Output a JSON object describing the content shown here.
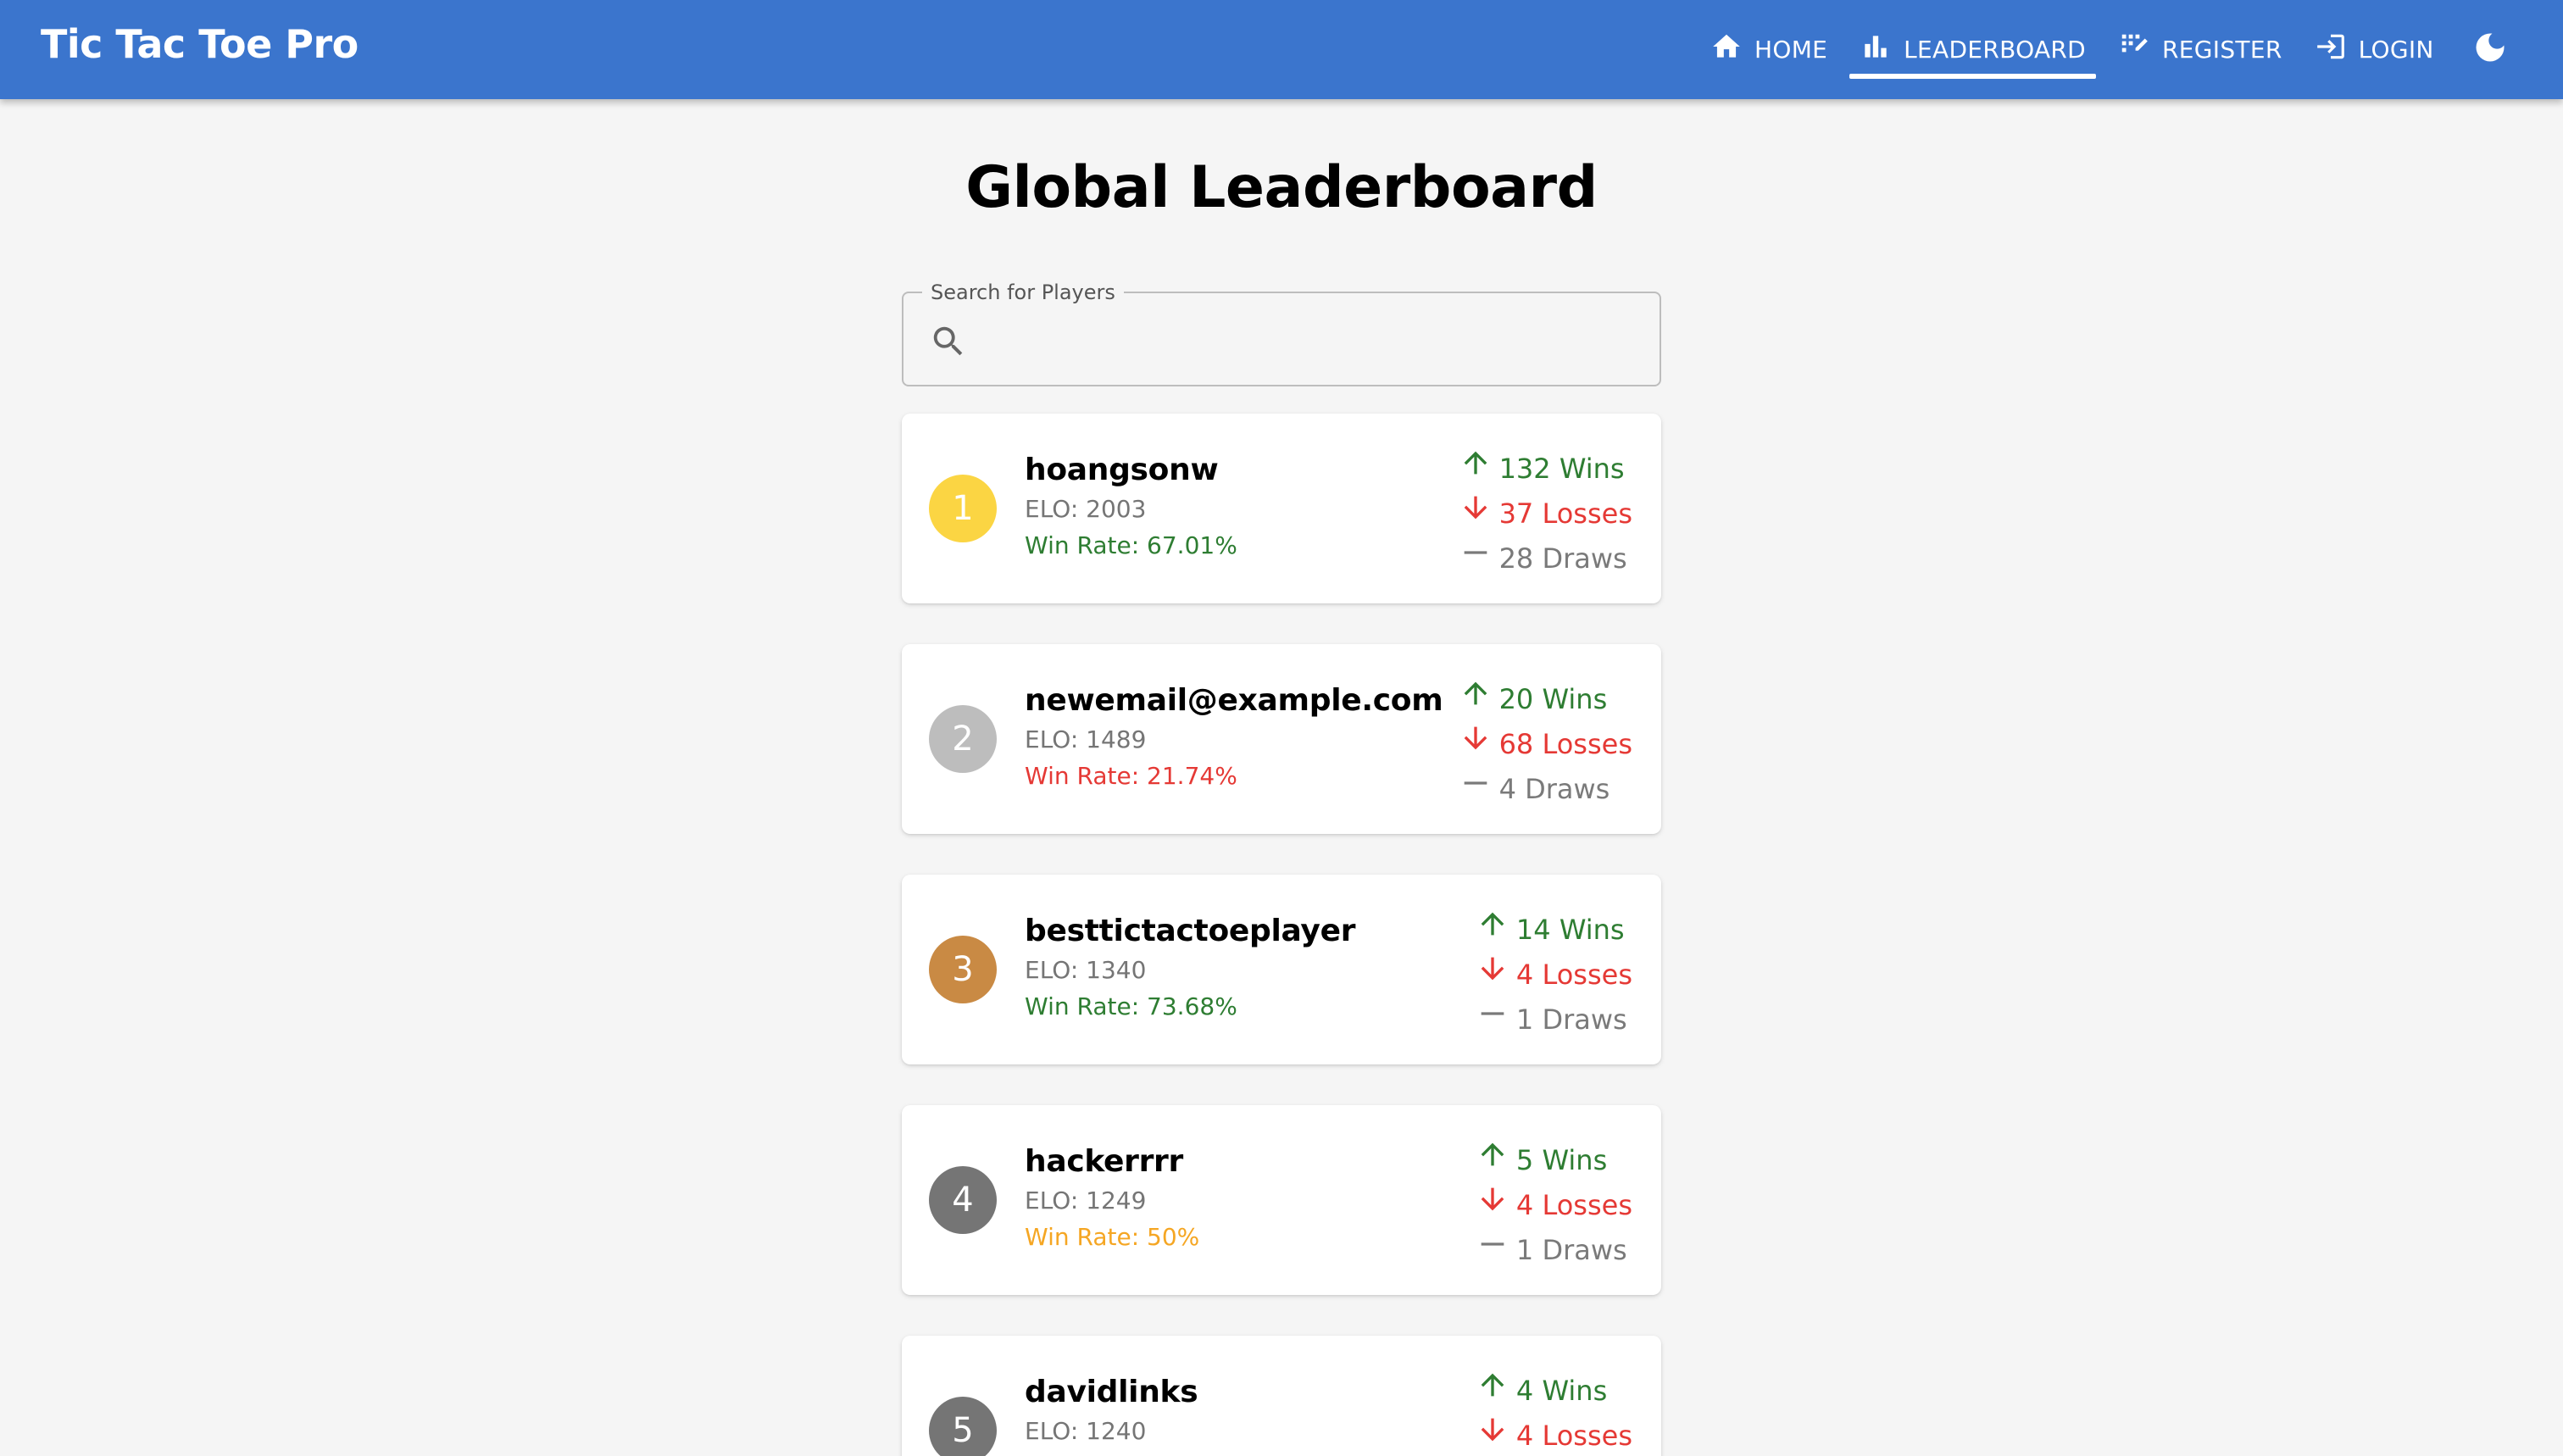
{
  "app": {
    "title": "Tic Tac Toe Pro"
  },
  "nav": {
    "home": "HOME",
    "leaderboard": "LEADERBOARD",
    "register": "REGISTER",
    "login": "LOGIN"
  },
  "page": {
    "title": "Global Leaderboard"
  },
  "search": {
    "label": "Search for Players",
    "value": ""
  },
  "colors": {
    "appbar": "#3b75cd",
    "gold": "#fbd543",
    "silver": "#bdbdbd",
    "bronze": "#c98a44",
    "default_rank": "#757575",
    "win": "#2e7d32",
    "loss": "#e53935",
    "draw": "#7a7a7a",
    "even": "#f5a623"
  },
  "players": [
    {
      "rank": "1",
      "name": "hoangsonw",
      "elo": "ELO: 2003",
      "win_rate": "Win Rate: 67.01%",
      "wins": "132 Wins",
      "losses": "37 Losses",
      "draws": "28 Draws"
    },
    {
      "rank": "2",
      "name": "newemail@example.com",
      "elo": "ELO: 1489",
      "win_rate": "Win Rate: 21.74%",
      "wins": "20 Wins",
      "losses": "68 Losses",
      "draws": "4 Draws"
    },
    {
      "rank": "3",
      "name": "besttictactoeplayer",
      "elo": "ELO: 1340",
      "win_rate": "Win Rate: 73.68%",
      "wins": "14 Wins",
      "losses": "4 Losses",
      "draws": "1 Draws"
    },
    {
      "rank": "4",
      "name": "hackerrrr",
      "elo": "ELO: 1249",
      "win_rate": "Win Rate: 50%",
      "wins": "5 Wins",
      "losses": "4 Losses",
      "draws": "1 Draws"
    },
    {
      "rank": "5",
      "name": "davidlinks",
      "elo": "ELO: 1240",
      "win_rate": "",
      "wins": "4 Wins",
      "losses": "4 Losses",
      "draws": ""
    }
  ]
}
